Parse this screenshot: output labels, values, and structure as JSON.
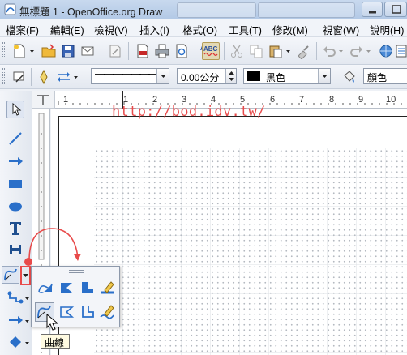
{
  "window": {
    "title": "無標題 1 - OpenOffice.org Draw"
  },
  "menu": {
    "items": [
      "檔案(F)",
      "編輯(E)",
      "檢視(V)",
      "插入(I)",
      "格式(O)",
      "工具(T)",
      "修改(M)",
      "視窗(W)",
      "說明(H)"
    ]
  },
  "toolbar2": {
    "line_style_value": "———————",
    "line_width_value": "0.00公分",
    "line_color_value": "黑色",
    "line_color_swatch": "#000000",
    "area_style_value": "顏色"
  },
  "ruler": {
    "h_ticks": [
      "1",
      "1",
      "2",
      "3",
      "4",
      "5",
      "6",
      "7",
      "8",
      "9",
      "10"
    ]
  },
  "watermark": "http://bod.idv.tw/",
  "tooltip": {
    "text": "曲線"
  },
  "colors": {
    "accent_red": "#e84a4a",
    "tool_blue": "#2a6fc9"
  }
}
